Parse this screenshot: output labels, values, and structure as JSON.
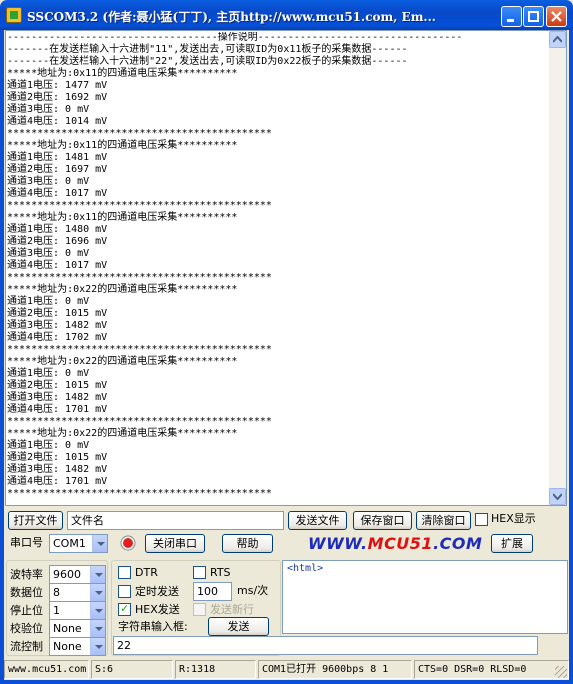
{
  "window": {
    "title": "SSCOM3.2 (作者:聂小猛(丁丁), 主页http://www.mcu51.com,  Em..."
  },
  "output": {
    "lines": [
      "-----------------------------------操作说明----------------------------------",
      "-------在发送栏输入十六进制\"11\",发送出去,可读取ID为0x11板子的采集数据------",
      "-------在发送栏输入十六进制\"22\",发送出去,可读取ID为0x22板子的采集数据------",
      "*****地址为:0x11的四通道电压采集**********",
      "通道1电压: 1477 mV",
      "通道2电压: 1692 mV",
      "通道3电压: 0 mV",
      "通道4电压: 1014 mV",
      "********************************************",
      "*****地址为:0x11的四通道电压采集**********",
      "通道1电压: 1481 mV",
      "通道2电压: 1697 mV",
      "通道3电压: 0 mV",
      "通道4电压: 1017 mV",
      "********************************************",
      "*****地址为:0x11的四通道电压采集**********",
      "通道1电压: 1480 mV",
      "通道2电压: 1696 mV",
      "通道3电压: 0 mV",
      "通道4电压: 1017 mV",
      "********************************************",
      "*****地址为:0x22的四通道电压采集**********",
      "通道1电压: 0 mV",
      "通道2电压: 1015 mV",
      "通道3电压: 1482 mV",
      "通道4电压: 1702 mV",
      "********************************************",
      "*****地址为:0x22的四通道电压采集**********",
      "通道1电压: 0 mV",
      "通道2电压: 1015 mV",
      "通道3电压: 1482 mV",
      "通道4电压: 1701 mV",
      "********************************************",
      "*****地址为:0x22的四通道电压采集**********",
      "通道1电压: 0 mV",
      "通道2电压: 1015 mV",
      "通道3电压: 1482 mV",
      "通道4电压: 1701 mV",
      "********************************************"
    ]
  },
  "row1": {
    "open_file": "打开文件",
    "filename": "文件名",
    "send_file": "发送文件",
    "save_window": "保存窗口",
    "clear_window": "清除窗口",
    "hex_display": "HEX显示"
  },
  "row2": {
    "port_label": "串口号",
    "port_value": "COM1",
    "close_port": "关闭串口",
    "help": "帮助",
    "logo_a": "WWW.",
    "logo_b": "MCU51",
    "logo_c": ".COM",
    "expand": "扩展"
  },
  "settings": {
    "baud_label": "波特率",
    "baud_value": "9600",
    "databits_label": "数据位",
    "databits_value": "8",
    "stopbits_label": "停止位",
    "stopbits_value": "1",
    "parity_label": "校验位",
    "parity_value": "None",
    "flow_label": "流控制",
    "flow_value": "None"
  },
  "options": {
    "dtr": "DTR",
    "rts": "RTS",
    "timed_send": "定时发送",
    "interval": "100",
    "interval_unit": "ms/次",
    "hex_send": "HEX发送",
    "send_newline": "发送新行",
    "input_label": "字符串输入框:",
    "send": "发送",
    "input_value": "22"
  },
  "preview": {
    "text": "<html>"
  },
  "status": {
    "site": "www.mcu51.com",
    "sent": "S:6",
    "received": "R:1318",
    "port_state": "COM1已打开  9600bps  8 1",
    "signals": "CTS=0 DSR=0 RLSD=0"
  }
}
